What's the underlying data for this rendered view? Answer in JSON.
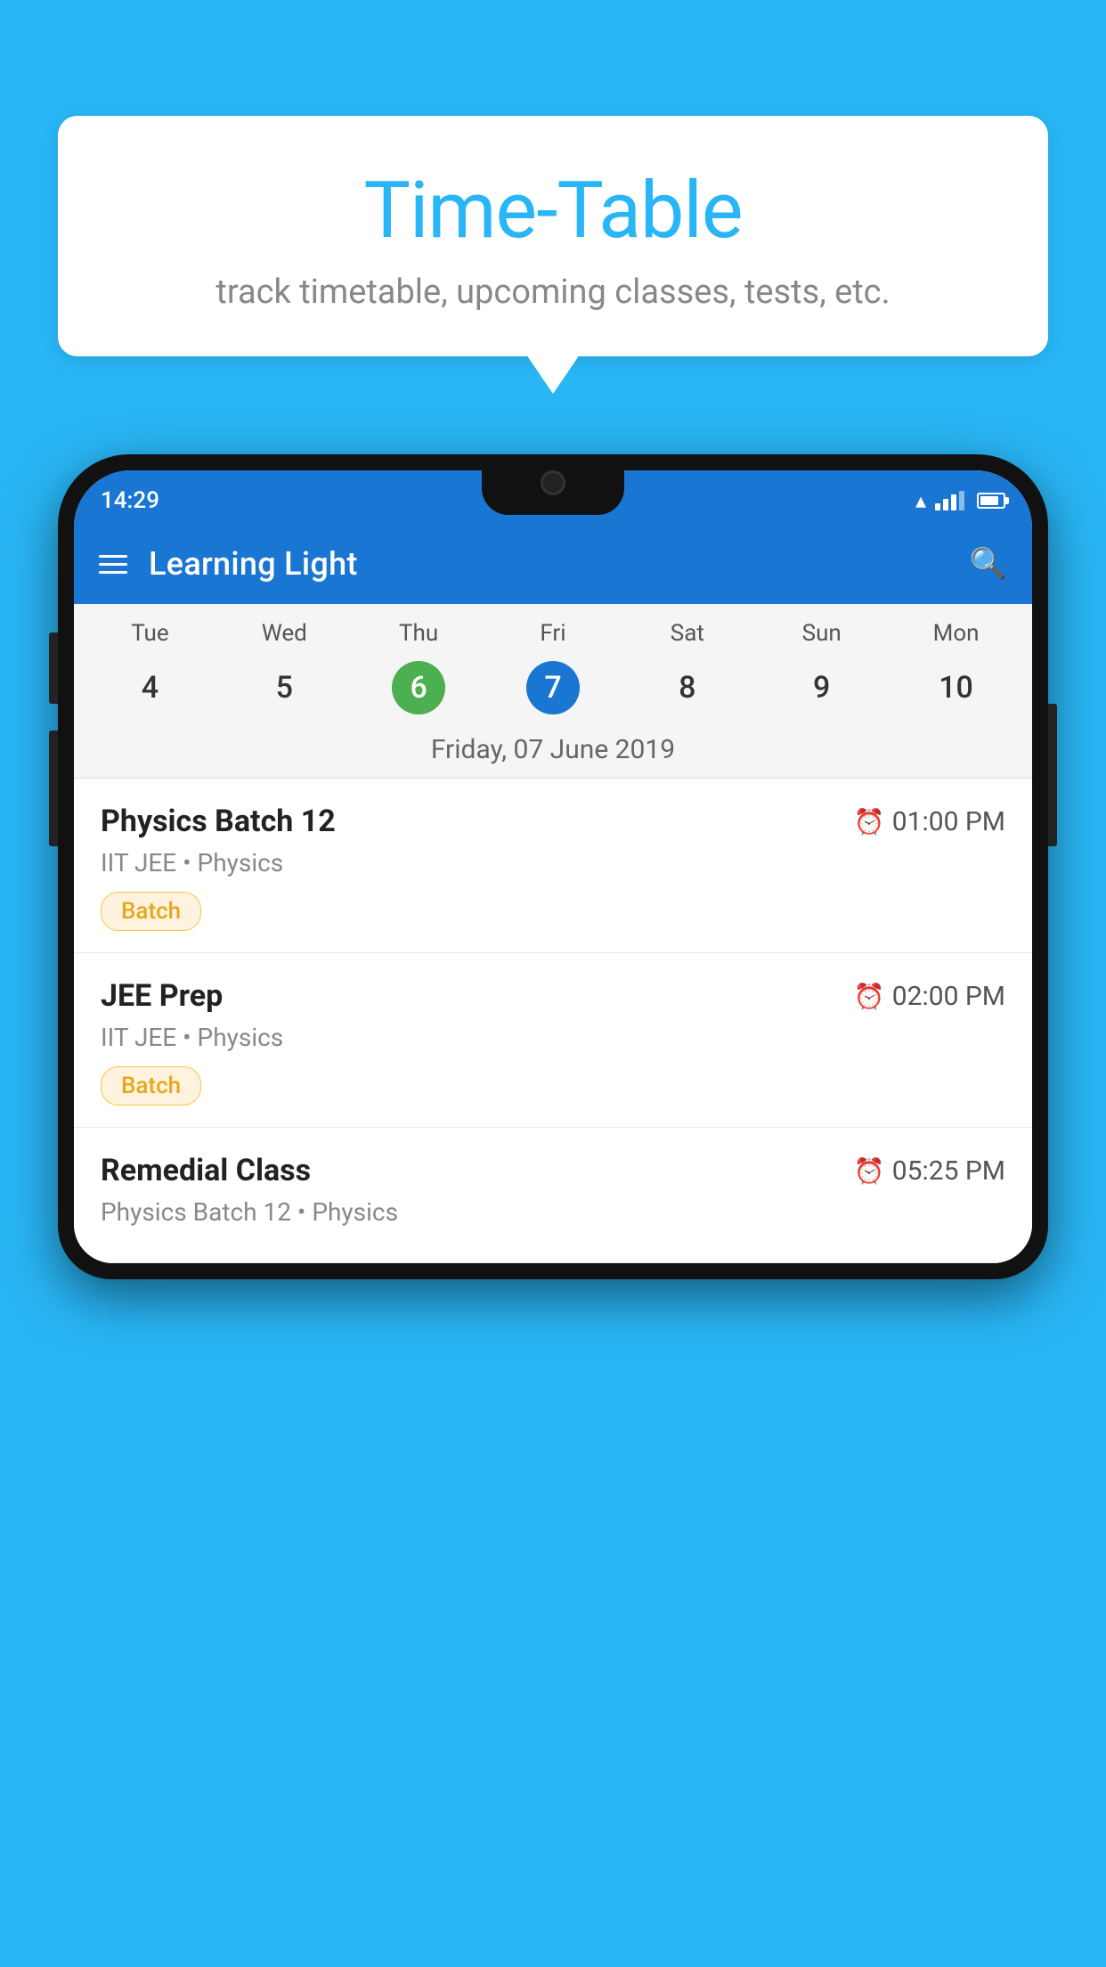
{
  "background": {
    "color": "#29B6F6"
  },
  "bubble": {
    "title": "Time-Table",
    "subtitle": "track timetable, upcoming classes, tests, etc."
  },
  "phone": {
    "status_bar": {
      "time": "14:29"
    },
    "app_bar": {
      "title": "Learning Light"
    },
    "calendar": {
      "days": [
        "Tue",
        "Wed",
        "Thu",
        "Fri",
        "Sat",
        "Sun",
        "Mon"
      ],
      "dates": [
        "4",
        "5",
        "6",
        "7",
        "8",
        "9",
        "10"
      ],
      "today_index": 2,
      "selected_index": 3,
      "selected_label": "Friday, 07 June 2019"
    },
    "classes": [
      {
        "name": "Physics Batch 12",
        "time": "01:00 PM",
        "meta": "IIT JEE • Physics",
        "tag": "Batch"
      },
      {
        "name": "JEE Prep",
        "time": "02:00 PM",
        "meta": "IIT JEE • Physics",
        "tag": "Batch"
      },
      {
        "name": "Remedial Class",
        "time": "05:25 PM",
        "meta": "Physics Batch 12 • Physics",
        "tag": ""
      }
    ]
  }
}
